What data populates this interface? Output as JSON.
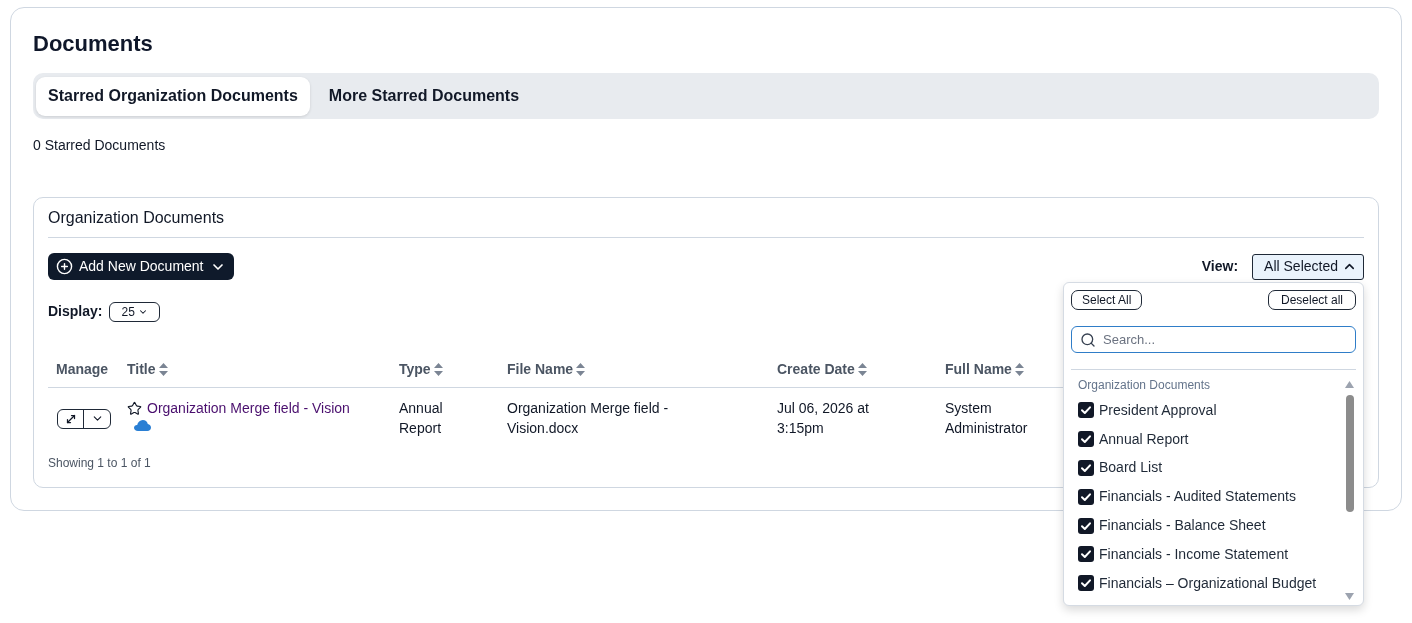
{
  "page": {
    "title": "Documents"
  },
  "tabs": [
    {
      "label": "Starred Organization Documents",
      "selected": true
    },
    {
      "label": "More Starred Documents",
      "selected": false
    }
  ],
  "starred_count": "0 Starred Documents",
  "panel": {
    "title": "Organization Documents",
    "add_button": "Add New Document",
    "view_label": "View:",
    "view_value": "All Selected",
    "view_expanded": true,
    "display_label": "Display:",
    "display_value": "25"
  },
  "table": {
    "columns": [
      {
        "label": "Manage",
        "sortable": false
      },
      {
        "label": "Title",
        "sortable": true
      },
      {
        "label": "Type",
        "sortable": true
      },
      {
        "label": "File Name",
        "sortable": true
      },
      {
        "label": "Create Date",
        "sortable": true
      },
      {
        "label": "Full Name",
        "sortable": true
      }
    ],
    "rows": [
      {
        "title": "Organization Merge field - Vision",
        "starred": false,
        "type": "Annual Report",
        "file_name": "Organization Merge field - Vision.docx",
        "create_date": "Jul 06, 2026 at 3:15pm",
        "full_name": "System Administrator"
      }
    ],
    "footer": "Showing 1 to 1 of 1"
  },
  "view_menu": {
    "select_all": "Select All",
    "deselect_all": "Deselect all",
    "search_placeholder": "Search...",
    "group_label": "Organization Documents",
    "items": [
      {
        "label": "President Approval",
        "checked": true
      },
      {
        "label": "Annual Report",
        "checked": true
      },
      {
        "label": "Board List",
        "checked": true
      },
      {
        "label": "Financials - Audited Statements",
        "checked": true
      },
      {
        "label": "Financials - Balance Sheet",
        "checked": true
      },
      {
        "label": "Financials - Income Statement",
        "checked": true
      },
      {
        "label": "Financials – Organizational Budget",
        "checked": true
      }
    ]
  }
}
